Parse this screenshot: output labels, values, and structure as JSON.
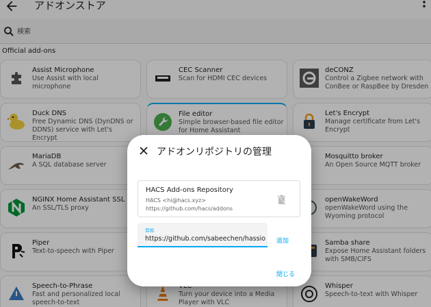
{
  "header": {
    "title": "アドオンストア"
  },
  "search": {
    "placeholder": "検索"
  },
  "section": {
    "title": "Official add-ons"
  },
  "cards": [
    {
      "name": "Assist Microphone",
      "desc": "Use Assist with local microphone",
      "icon": "puzzle-icon"
    },
    {
      "name": "CEC Scanner",
      "desc": "Scan for HDMI CEC devices",
      "icon": "hdmi-icon"
    },
    {
      "name": "deCONZ",
      "desc": "Control a Zigbee network with ConBee or RaspBee by Dresden",
      "icon": "deconz-logo-icon"
    },
    {
      "name": "Duck DNS",
      "desc": "Free Dynamic DNS (DynDNS or DDNS) service with Let's Encrypt",
      "icon": "duck-icon"
    },
    {
      "name": "File editor",
      "desc": "Simple browser-based file editor for Home Assistant",
      "icon": "wrench-icon"
    },
    {
      "name": "Let's Encrypt",
      "desc": "Manage certificate from Let's Encrypt",
      "icon": "lock-icon"
    },
    {
      "name": "MariaDB",
      "desc": "A SQL database server",
      "icon": "seal-icon"
    },
    {
      "name": "Mosquitto broker",
      "desc": "An Open Source MQTT broker",
      "icon": "mqtt-icon"
    },
    {
      "name": "NGINX Home Assistant SSL proxy",
      "desc": "An SSL/TLS proxy",
      "icon": "nginx-icon"
    },
    {
      "name": "openWakeWord",
      "desc": "openWakeWord using the Wyoming protocol",
      "icon": "wake-icon"
    },
    {
      "name": "Piper",
      "desc": "Text-to-speech with Piper",
      "icon": "piper-icon"
    },
    {
      "name": "Samba share",
      "desc": "Expose Home Assistant folders with SMB/CIFS",
      "icon": "samba-icon"
    },
    {
      "name": "Speech-to-Phrase",
      "desc": "Fast and personalized local speech-to-text",
      "icon": "speech-icon"
    },
    {
      "name": "VLC",
      "desc": "Turn your device into a Media Player with VLC",
      "icon": "vlc-cone-icon"
    },
    {
      "name": "Whisper",
      "desc": "Speech-to-text with Whisper",
      "icon": "openai-icon"
    }
  ],
  "dialog": {
    "title": "アドオンリポジトリの管理",
    "repo": {
      "name": "HACS Add-ons Repository",
      "author": "HACS <hi@hacs.xyz>",
      "url": "https://github.com/hacs/addons"
    },
    "input": {
      "label": "追加",
      "value": "https://github.com/sabeechen/hassio-google-drive-backup"
    },
    "add_label": "追加",
    "close_label": "閉じる"
  },
  "colors": {
    "accent": "#03a9f4",
    "scrim": "rgba(0,0,0,0.30)"
  }
}
